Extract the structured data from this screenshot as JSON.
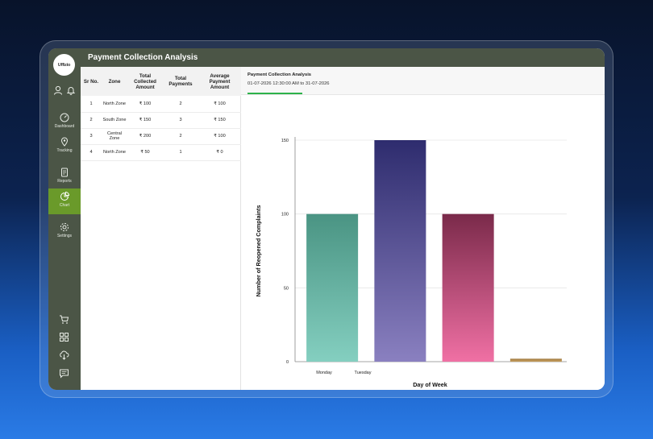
{
  "app": {
    "logo_text": "Uffizio",
    "window_title": "Payment Collection Analysis"
  },
  "sidebar": {
    "items": [
      {
        "label": "Dashboard",
        "icon": "dashboard-gauge-icon"
      },
      {
        "label": "Tracking",
        "icon": "tracking-pin-icon"
      },
      {
        "label": "Reports",
        "icon": "reports-document-icon"
      },
      {
        "label": "Chart",
        "icon": "chart-pie-icon",
        "active": true
      },
      {
        "label": "Settings",
        "icon": "settings-gear-icon"
      }
    ],
    "active_color": "#6a9a2a",
    "bottom_icons": [
      "cart-icon",
      "apps-grid-icon",
      "cloud-download-icon",
      "feedback-icon"
    ]
  },
  "table": {
    "columns": [
      "Sr No.",
      "Zone",
      "Total Collected Amount",
      "Total Payments",
      "Average Payment Amount"
    ],
    "rows": [
      [
        "1",
        "North Zone",
        "₹ 100",
        "2",
        "₹ 100"
      ],
      [
        "2",
        "South Zone",
        "₹ 150",
        "3",
        "₹ 150"
      ],
      [
        "3",
        "Central Zone",
        "₹ 200",
        "2",
        "₹ 100"
      ],
      [
        "4",
        "North Zone",
        "₹ 50",
        "1",
        "₹ 0"
      ]
    ]
  },
  "chart_panel": {
    "title": "Payment Collection Analysis",
    "date_range": "01-07-2026 12:30:00 AM to 31-07-2026",
    "tab_color": "#2db24a"
  },
  "chart_data": {
    "type": "bar",
    "categories": [
      "Monday",
      "Tuesday",
      "",
      ""
    ],
    "values": [
      100,
      150,
      100,
      2
    ],
    "xlabel": "Day of Week",
    "ylabel": "Number of Reopened Complaints",
    "ylim": [
      0,
      150
    ],
    "yticks": [
      0,
      50,
      100,
      150
    ],
    "grid": true,
    "bar_colors": [
      [
        "#4a9483",
        "#84cfc0"
      ],
      [
        "#2e2c6e",
        "#8a80c0"
      ],
      [
        "#7a2a4a",
        "#f070a4"
      ],
      [
        "#a07a40",
        "#c8a060"
      ]
    ]
  }
}
